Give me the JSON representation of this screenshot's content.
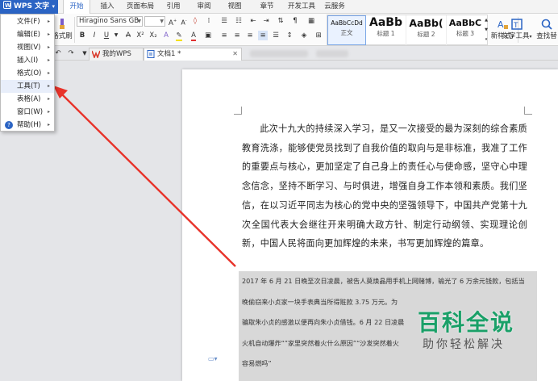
{
  "app": {
    "name": "WPS 文字",
    "accent": "#2b64c4"
  },
  "tabs": [
    "开始",
    "插入",
    "页面布局",
    "引用",
    "审阅",
    "视图",
    "章节",
    "开发工具",
    "云服务"
  ],
  "ribbon": {
    "format_painter": "格式刷",
    "font_name": "Hiragino Sans GB",
    "bold": "B",
    "italic": "I",
    "underline": "U",
    "styles": [
      {
        "sample": "AaBbCcDd",
        "caption": "正文"
      },
      {
        "sample": "AaBb",
        "caption": "标题 1"
      },
      {
        "sample": "AaBb(",
        "caption": "标题 2"
      },
      {
        "sample": "AaBbC",
        "caption": "标题 3"
      }
    ],
    "new_style": "新样式",
    "text_tools": "文字工具",
    "find_replace": "查找替"
  },
  "doc_tabs": [
    {
      "label": "我的WPS",
      "active": false
    },
    {
      "label": "文档1 *",
      "active": true
    }
  ],
  "menu": {
    "items": [
      {
        "label": "文件(F)",
        "submenu": true
      },
      {
        "label": "编辑(E)",
        "submenu": true
      },
      {
        "label": "视图(V)",
        "submenu": true
      },
      {
        "label": "插入(I)",
        "submenu": true
      },
      {
        "label": "格式(O)",
        "submenu": true
      },
      {
        "label": "工具(T)",
        "submenu": true
      },
      {
        "label": "表格(A)",
        "submenu": true
      },
      {
        "label": "窗口(W)",
        "submenu": true
      },
      {
        "label": "帮助(H)",
        "submenu": true
      }
    ]
  },
  "document": {
    "paragraph1": "此次十九大的持续深入学习，是又一次接受的最为深刻的综合素质教育洗涤，能够使党员找到了自我价值的取向与是非标准，我准了工作的重要点与核心，更加坚定了自己身上的责任心与使命感，坚守心中理念信念，坚持不断学习、与时俱进，增强自身工作本领和素质。我们坚信，在以习近平同志为核心的党中央的坚强领导下，中国共产党第十九次全国代表大会继往开来明确大政方针、制定行动纲领、实现理论创新，中国人民将面向更加辉煌的未来，书写更加辉煌的篇章。",
    "paragraph2_lines": [
      "2017 年 6 月 21 日晚至次日凌晨，被告人莫焕晶用手机上网赌博，输光了 6 万余元钱款，包括当",
      "晚偷窃来小贞家一块手表典当所得赃款 3.75 万元。为",
      "骗取朱小贞的感激以便再向朱小贞借钱。6 月 22 日凌晨",
      "火机自动爆炸“”家里突然着火什么原因”“沙发突然着火",
      "容易燃吗”"
    ]
  },
  "watermark": {
    "title": "百科全说",
    "subtitle": "助你轻松解决"
  }
}
